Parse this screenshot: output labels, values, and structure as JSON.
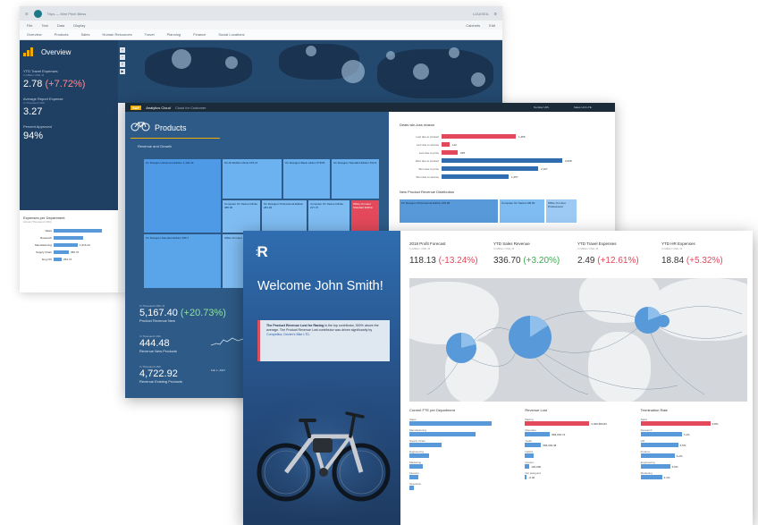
{
  "win1": {
    "shell": {
      "app_title": "Trips — Mim Prlch Bless",
      "user": "LOUISEA",
      "links": [
        "Cabinets",
        "Edit"
      ]
    },
    "menu": [
      "File",
      "Test",
      "Data",
      "Display"
    ],
    "tabs": [
      "Overview",
      "Products",
      "Sales",
      "Human Resources",
      "Travel",
      "Planning",
      "Finance",
      "Social Locations"
    ],
    "overview_title": "Overview",
    "kpis": [
      {
        "label": "YTD Travel Expenses",
        "sub": "In Million USD, M",
        "value": "2.78",
        "delta": "(+7.72%)"
      },
      {
        "label": "Average Report Expense",
        "sub": "In Thousand USD",
        "value": "3.27",
        "delta": ""
      },
      {
        "label": "Percent Approved",
        "sub": "",
        "value": "94%",
        "delta": ""
      }
    ],
    "dept_title": "Expenses per Department",
    "dept_sub": "Actual (Thousand USD)",
    "dept_bars": [
      {
        "label": "Sales",
        "pct": 0.9,
        "value": ""
      },
      {
        "label": "Research",
        "pct": 0.55,
        "value": ""
      },
      {
        "label": "Manufacturing",
        "pct": 0.45,
        "value": "1,015.44"
      },
      {
        "label": "Supply Chain",
        "pct": 0.28,
        "value": "350.70"
      },
      {
        "label": "Eng Ctrl",
        "pct": 0.15,
        "value": "254.74"
      }
    ]
  },
  "win2": {
    "shell": {
      "brand": "SAP",
      "product": "Analytics Cloud",
      "sub": "Cloud for Customer",
      "kpi_a": "Number UPL",
      "kpi_b": "Sales Unit LTE"
    },
    "title": "Products",
    "section": "Revenue and Growth",
    "treemap": [
      {
        "label": "On Designer Advanced Edition 1,129.43",
        "color": "#4e9ae6"
      },
      {
        "label": "On All Mobile Infinite 676.21",
        "color": "#6cb1f0"
      },
      {
        "label": "On Designer Basic edition 578.81",
        "color": "#6cb1f0"
      },
      {
        "label": "On Designer Standard Edition 512.9",
        "color": "#6cb1f0"
      },
      {
        "label": "Computer On Series Infinite 385.06",
        "color": "#7fbcf2"
      },
      {
        "label": "On Designer Professional Edition 281.36",
        "color": "#7fbcf2"
      },
      {
        "label": "Computer On Series Infinite 217.37",
        "color": "#7fbcf2"
      },
      {
        "label": "Office On Hour Standard Edition",
        "color": "#e3495a"
      },
      {
        "label": "On Designer Standard Edition 545.7",
        "color": "#5aa5ea"
      },
      {
        "label": "Office On Hour Professional",
        "color": "#7fbcf2"
      }
    ],
    "kpis": [
      {
        "sub": "In Thousand USD, M",
        "value": "5,167.40",
        "delta": "(+20.73%)",
        "label": "Product Revenue New"
      },
      {
        "sub": "In Thousand USD",
        "value": "444.48",
        "delta": "",
        "label": "Revenue New Products"
      },
      {
        "sub": "In Thousand USD",
        "value": "4,722.92",
        "delta": "",
        "label": "Revenue Existing Products"
      }
    ],
    "date_label": "Feb 1, 2017",
    "right": {
      "deals_title": "Deals win-loss reason",
      "deals": [
        {
          "label": "Lost due to product",
          "pct": 0.55,
          "value": "1,456",
          "color": "#e3495a"
        },
        {
          "label": "Lost due to service",
          "pct": 0.06,
          "value": "112",
          "color": "#e3495a"
        },
        {
          "label": "Lost due to price",
          "pct": 0.12,
          "value": "238",
          "color": "#e3495a"
        },
        {
          "label": "Won due to product",
          "pct": 0.9,
          "value": "2,608",
          "color": "#2f6db0"
        },
        {
          "label": "Won due to price",
          "pct": 0.72,
          "value": "2,107",
          "color": "#2f6db0"
        },
        {
          "label": "Won due to service",
          "pct": 0.5,
          "value": "1,257",
          "color": "#2f6db0"
        }
      ],
      "np_title": "New Product Revenue Distribution",
      "np_blocks": [
        "On Designer Professional Edition 203.28",
        "Computer On Series 105.00",
        "Office On Hour Professional"
      ]
    }
  },
  "win3": {
    "logo": "R",
    "welcome": "Welcome John Smith!",
    "note_bold": "The Product Revenue Lost for Racing",
    "note_text": "is the top contributor, 300% above the average. The Product Revenue Lost contributor was driven significantly by",
    "note_link": "Competitor, Dexter's Bike LTD.",
    "kpis": [
      {
        "label": "2018 Profit Forecast",
        "sub": "In Million USD, M",
        "value": "118.13",
        "delta": "(-13.24%)",
        "tone": "neg"
      },
      {
        "label": "YTD Sales Revenue",
        "sub": "In Million USD, M",
        "value": "336.70",
        "delta": "(+3.20%)",
        "tone": "pos"
      },
      {
        "label": "YTD Travel Expenses",
        "sub": "In Million USD, M",
        "value": "2.49",
        "delta": "(+12.61%)",
        "tone": "neg"
      },
      {
        "label": "YTD HR Expenses",
        "sub": "In Million USD, M",
        "value": "18.84",
        "delta": "(+5.32%)",
        "tone": "neg"
      }
    ],
    "panels": [
      {
        "title": "Current FTE per Department",
        "bars": [
          {
            "label": "Sales",
            "pct": 0.92,
            "value": "",
            "color": "#5899da"
          },
          {
            "label": "Manufacturing",
            "pct": 0.74,
            "value": "",
            "color": "#5899da"
          },
          {
            "label": "Supply Chain",
            "pct": 0.36,
            "value": "",
            "color": "#5899da"
          },
          {
            "label": "Engineering",
            "pct": 0.22,
            "value": "",
            "color": "#5899da"
          },
          {
            "label": "Marketing",
            "pct": 0.15,
            "value": "",
            "color": "#5899da"
          },
          {
            "label": "Finance",
            "pct": 0.1,
            "value": "",
            "color": "#5899da"
          },
          {
            "label": "Operation",
            "pct": 0.05,
            "value": "",
            "color": "#5899da"
          }
        ]
      },
      {
        "title": "Revenue Lost",
        "bars": [
          {
            "label": "Racing",
            "pct": 0.72,
            "value": "3,020,584.84",
            "color": "#e3495a"
          },
          {
            "label": "Mountain",
            "pct": 0.28,
            "value": "866,015.72",
            "color": "#5899da"
          },
          {
            "label": "Youth",
            "pct": 0.18,
            "value": "596,004.48",
            "color": "#5899da"
          },
          {
            "label": "Hybrid",
            "pct": 0.1,
            "value": "",
            "color": "#5899da"
          },
          {
            "label": "Cruiser",
            "pct": 0.05,
            "value": "120,000",
            "color": "#5899da"
          },
          {
            "label": "Not assigned",
            "pct": 0.0,
            "value": "-0.00",
            "color": "#5899da"
          }
        ]
      },
      {
        "title": "Termination Rate",
        "bars": [
          {
            "label": "Sales",
            "pct": 0.78,
            "value": "9.8%",
            "color": "#e3495a"
          },
          {
            "label": "Research",
            "pct": 0.46,
            "value": "7.2%",
            "color": "#5899da"
          },
          {
            "label": "HR",
            "pct": 0.42,
            "value": "6.5%",
            "color": "#5899da"
          },
          {
            "label": "Finance",
            "pct": 0.38,
            "value": "6.2%",
            "color": "#5899da"
          },
          {
            "label": "Engineering",
            "pct": 0.33,
            "value": "5.9%",
            "color": "#5899da"
          },
          {
            "label": "Marketing",
            "pct": 0.24,
            "value": "4.1%",
            "color": "#5899da"
          }
        ]
      }
    ]
  }
}
